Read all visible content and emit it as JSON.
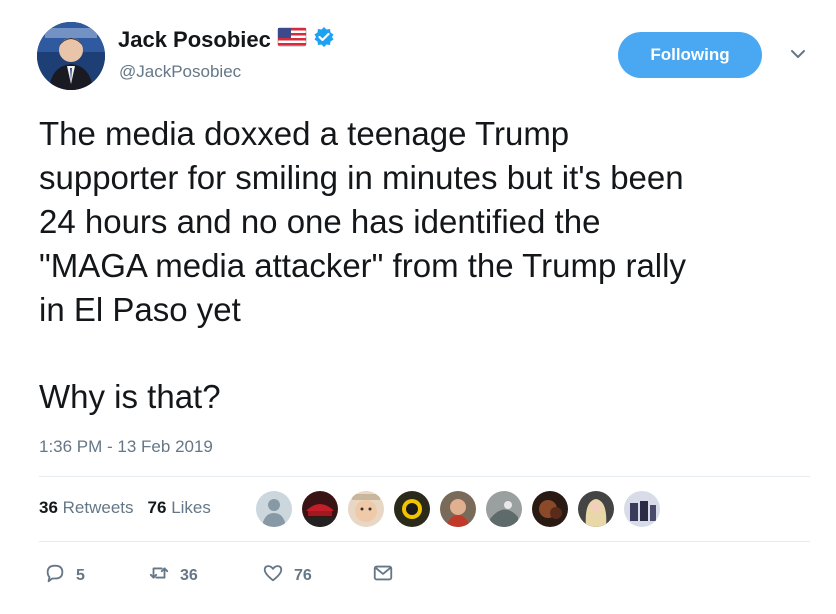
{
  "author": {
    "display_name": "Jack Posobiec",
    "handle": "@JackPosobiec",
    "flag_icon": "us-flag-icon",
    "verified_icon": "verified-badge-icon"
  },
  "follow_button": {
    "label": "Following",
    "color": "#4aa8f3"
  },
  "tweet": {
    "text": "The media doxxed a teenage Trump\nsupporter for smiling in minutes but it's been\n24 hours and no one has identified the\n\"MAGA media attacker\" from the Trump rally\nin El Paso yet",
    "question": "Why is that?",
    "timestamp": "1:36 PM - 13 Feb 2019"
  },
  "stats": {
    "retweets_count": "36",
    "retweets_label": "Retweets",
    "likes_count": "76",
    "likes_label": "Likes"
  },
  "actions": {
    "reply_count": "5",
    "retweet_count": "36",
    "like_count": "76"
  },
  "colors": {
    "text_primary": "#14171a",
    "text_secondary": "#657786",
    "accent": "#1da1f2",
    "divider": "#e6ecf0"
  }
}
